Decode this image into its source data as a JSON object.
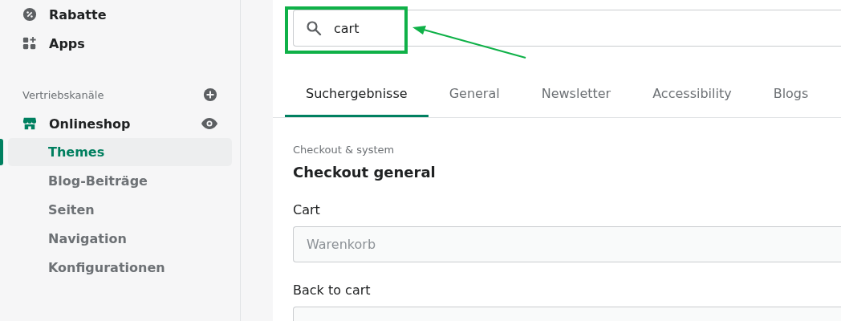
{
  "sidebar": {
    "items": [
      {
        "label": "Rabatte",
        "kind": "discount"
      },
      {
        "label": "Apps",
        "kind": "apps"
      }
    ],
    "channels": {
      "title": "Vertriebskanäle",
      "channel": {
        "label": "Onlineshop",
        "subitems": [
          {
            "label": "Themes",
            "selected": true
          },
          {
            "label": "Blog-Beiträge",
            "selected": false
          },
          {
            "label": "Seiten",
            "selected": false
          },
          {
            "label": "Navigation",
            "selected": false
          },
          {
            "label": "Konfigurationen",
            "selected": false
          }
        ]
      }
    }
  },
  "search": {
    "value": "cart"
  },
  "tabs": [
    {
      "label": "Suchergebnisse",
      "selected": true
    },
    {
      "label": "General",
      "selected": false
    },
    {
      "label": "Newsletter",
      "selected": false
    },
    {
      "label": "Accessibility",
      "selected": false
    },
    {
      "label": "Blogs",
      "selected": false
    }
  ],
  "section": {
    "breadcrumb": "Checkout & system",
    "title": "Checkout general"
  },
  "fields": [
    {
      "label": "Cart",
      "placeholder": "Warenkorb"
    },
    {
      "label": "Back to cart"
    }
  ]
}
